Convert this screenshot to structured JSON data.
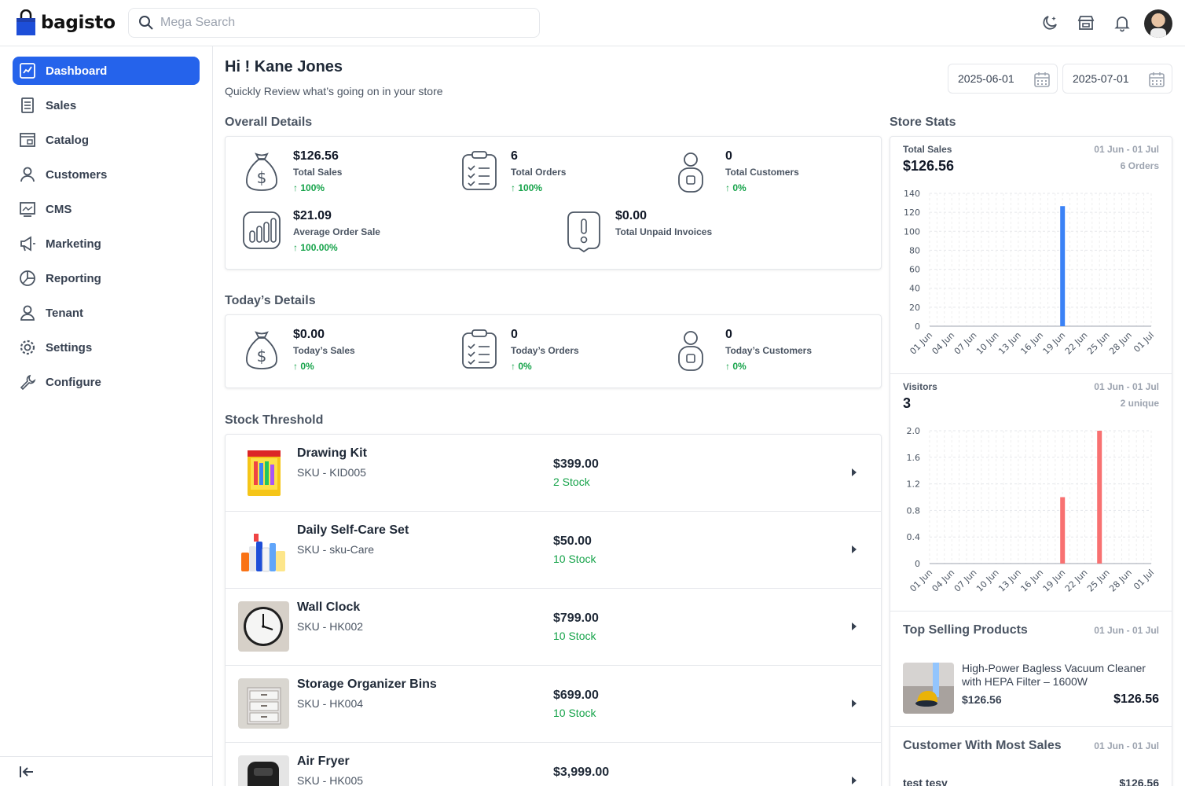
{
  "header": {
    "brand": "bagisto",
    "search_placeholder": "Mega Search"
  },
  "sidebar": {
    "items": [
      {
        "label": "Dashboard",
        "icon": "dashboard-icon",
        "active": true
      },
      {
        "label": "Sales",
        "icon": "sales-icon"
      },
      {
        "label": "Catalog",
        "icon": "catalog-icon"
      },
      {
        "label": "Customers",
        "icon": "customers-icon"
      },
      {
        "label": "CMS",
        "icon": "cms-icon"
      },
      {
        "label": "Marketing",
        "icon": "marketing-icon"
      },
      {
        "label": "Reporting",
        "icon": "reporting-icon"
      },
      {
        "label": "Tenant",
        "icon": "tenant-icon"
      },
      {
        "label": "Settings",
        "icon": "settings-icon"
      },
      {
        "label": "Configure",
        "icon": "configure-icon"
      }
    ]
  },
  "page": {
    "greeting": "Hi ! Kane Jones",
    "subtitle": "Quickly Review what’s going on in your store",
    "date_start": "2025-06-01",
    "date_end": "2025-07-01"
  },
  "overall": {
    "title": "Overall Details",
    "total_sales": {
      "value": "$126.56",
      "label": "Total Sales",
      "pct": "100%"
    },
    "total_orders": {
      "value": "6",
      "label": "Total Orders",
      "pct": "100%"
    },
    "total_customers": {
      "value": "0",
      "label": "Total Customers",
      "pct": "0%"
    },
    "avg_order": {
      "value": "$21.09",
      "label": "Average Order Sale",
      "pct": "100.00%"
    },
    "unpaid": {
      "value": "$0.00",
      "label": "Total Unpaid Invoices"
    }
  },
  "today": {
    "title": "Today’s Details",
    "sales": {
      "value": "$0.00",
      "label": "Today’s Sales",
      "pct": "0%"
    },
    "orders": {
      "value": "0",
      "label": "Today’s Orders",
      "pct": "0%"
    },
    "customers": {
      "value": "0",
      "label": "Today’s Customers",
      "pct": "0%"
    }
  },
  "stock": {
    "title": "Stock Threshold",
    "items": [
      {
        "name": "Drawing Kit",
        "sku": "SKU - KID005",
        "price": "$399.00",
        "qty": "2 Stock"
      },
      {
        "name": "Daily Self-Care Set",
        "sku": "SKU - sku-Care",
        "price": "$50.00",
        "qty": "10 Stock"
      },
      {
        "name": "Wall Clock",
        "sku": "SKU - HK002",
        "price": "$799.00",
        "qty": "10 Stock"
      },
      {
        "name": "Storage Organizer Bins",
        "sku": "SKU - HK004",
        "price": "$699.00",
        "qty": "10 Stock"
      },
      {
        "name": "Air Fryer",
        "sku": "SKU - HK005",
        "price": "$3,999.00",
        "qty": ""
      }
    ]
  },
  "store_stats": {
    "title": "Store Stats",
    "sales": {
      "label": "Total Sales",
      "value": "$126.56",
      "range": "01 Jun - 01 Jul",
      "orders": "6 Orders"
    },
    "visitors": {
      "label": "Visitors",
      "value": "3",
      "range": "01 Jun - 01 Jul",
      "unique": "2 unique"
    },
    "top_selling": {
      "title": "Top Selling Products",
      "range": "01 Jun - 01 Jul",
      "product_name": "High-Power Bagless Vacuum Cleaner with HEPA Filter – 1600W",
      "price": "$126.56",
      "total": "$126.56"
    },
    "customer_most_sales": {
      "title": "Customer With Most Sales",
      "range": "01 Jun - 01 Jul",
      "name": "test tesy",
      "amount": "$126.56"
    }
  },
  "colors": {
    "accent": "#2563eb",
    "positive": "#16a34a",
    "sales_bar": "#3b82f6",
    "visitors_bar": "#f87171"
  },
  "chart_data": [
    {
      "type": "bar",
      "name": "sales",
      "x_ticks": [
        "01 Jun",
        "04 Jun",
        "07 Jun",
        "10 Jun",
        "13 Jun",
        "16 Jun",
        "19 Jun",
        "22 Jun",
        "25 Jun",
        "28 Jun",
        "01 Jul"
      ],
      "y_ticks": [
        "0",
        "20",
        "40",
        "60",
        "80",
        "100",
        "120",
        "140"
      ],
      "ylim": [
        0,
        140
      ],
      "days": 31,
      "points": [
        {
          "day": "19 Jun",
          "value": 126.56
        }
      ],
      "grid": true
    },
    {
      "type": "bar",
      "name": "visitors",
      "x_ticks": [
        "01 Jun",
        "04 Jun",
        "07 Jun",
        "10 Jun",
        "13 Jun",
        "16 Jun",
        "19 Jun",
        "22 Jun",
        "25 Jun",
        "28 Jun",
        "01 Jul"
      ],
      "y_ticks": [
        "0",
        "0.4",
        "0.8",
        "1.2",
        "1.6",
        "2.0"
      ],
      "ylim": [
        0,
        2
      ],
      "days": 31,
      "points": [
        {
          "day": "19 Jun",
          "value": 1
        },
        {
          "day": "24 Jun",
          "value": 2
        }
      ],
      "grid": true
    }
  ]
}
